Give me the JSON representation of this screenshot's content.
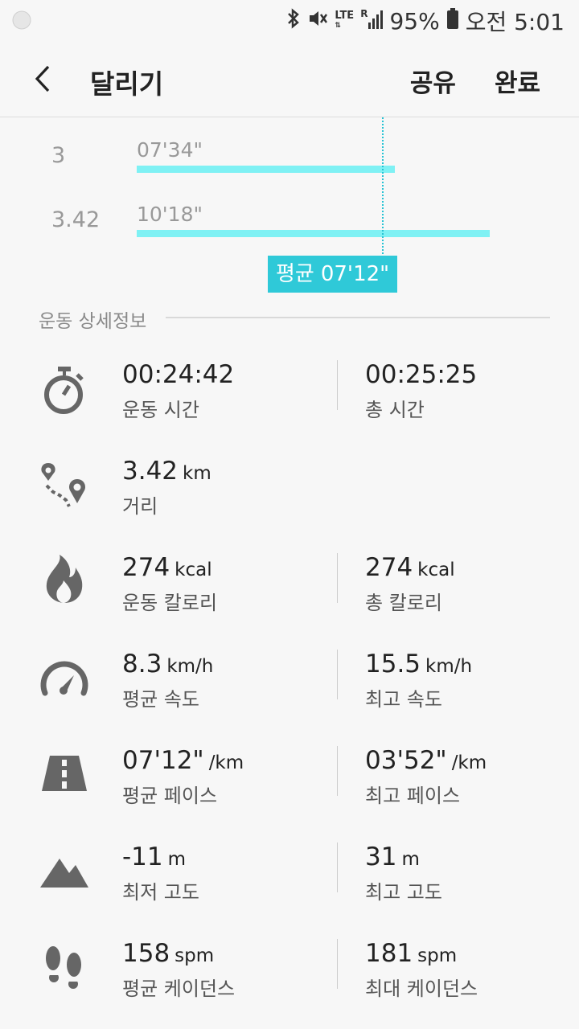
{
  "status": {
    "network": "LTE",
    "roaming": "R",
    "battery": "95%",
    "time": "오전 5:01"
  },
  "appbar": {
    "title": "달리기",
    "share": "공유",
    "done": "완료"
  },
  "splits": [
    {
      "km": "3",
      "pace": "07'34\"",
      "fraction": 0.63
    },
    {
      "km": "3.42",
      "pace": "10'18\"",
      "fraction": 0.86
    }
  ],
  "average": {
    "label": "평균",
    "pace": "07'12\""
  },
  "section_title": "운동 상세정보",
  "metrics": [
    {
      "icon": "stopwatch-icon",
      "left": {
        "value": "00:24:42",
        "unit": "",
        "label": "운동 시간"
      },
      "right": {
        "value": "00:25:25",
        "unit": "",
        "label": "총 시간"
      }
    },
    {
      "icon": "route-icon",
      "left": {
        "value": "3.42",
        "unit": "km",
        "label": "거리"
      },
      "right": null
    },
    {
      "icon": "flame-icon",
      "left": {
        "value": "274",
        "unit": "kcal",
        "label": "운동 칼로리"
      },
      "right": {
        "value": "274",
        "unit": "kcal",
        "label": "총 칼로리"
      }
    },
    {
      "icon": "speedometer-icon",
      "left": {
        "value": "8.3",
        "unit": "km/h",
        "label": "평균 속도"
      },
      "right": {
        "value": "15.5",
        "unit": "km/h",
        "label": "최고 속도"
      }
    },
    {
      "icon": "road-icon",
      "left": {
        "value": "07'12\"",
        "unit": "/km",
        "label": "평균 페이스"
      },
      "right": {
        "value": "03'52\"",
        "unit": "/km",
        "label": "최고 페이스"
      }
    },
    {
      "icon": "mountain-icon",
      "left": {
        "value": "-11",
        "unit": "m",
        "label": "최저 고도"
      },
      "right": {
        "value": "31",
        "unit": "m",
        "label": "최고 고도"
      }
    },
    {
      "icon": "footprints-icon",
      "left": {
        "value": "158",
        "unit": "spm",
        "label": "평균 케이던스"
      },
      "right": {
        "value": "181",
        "unit": "spm",
        "label": "최대 케이던스"
      }
    }
  ]
}
